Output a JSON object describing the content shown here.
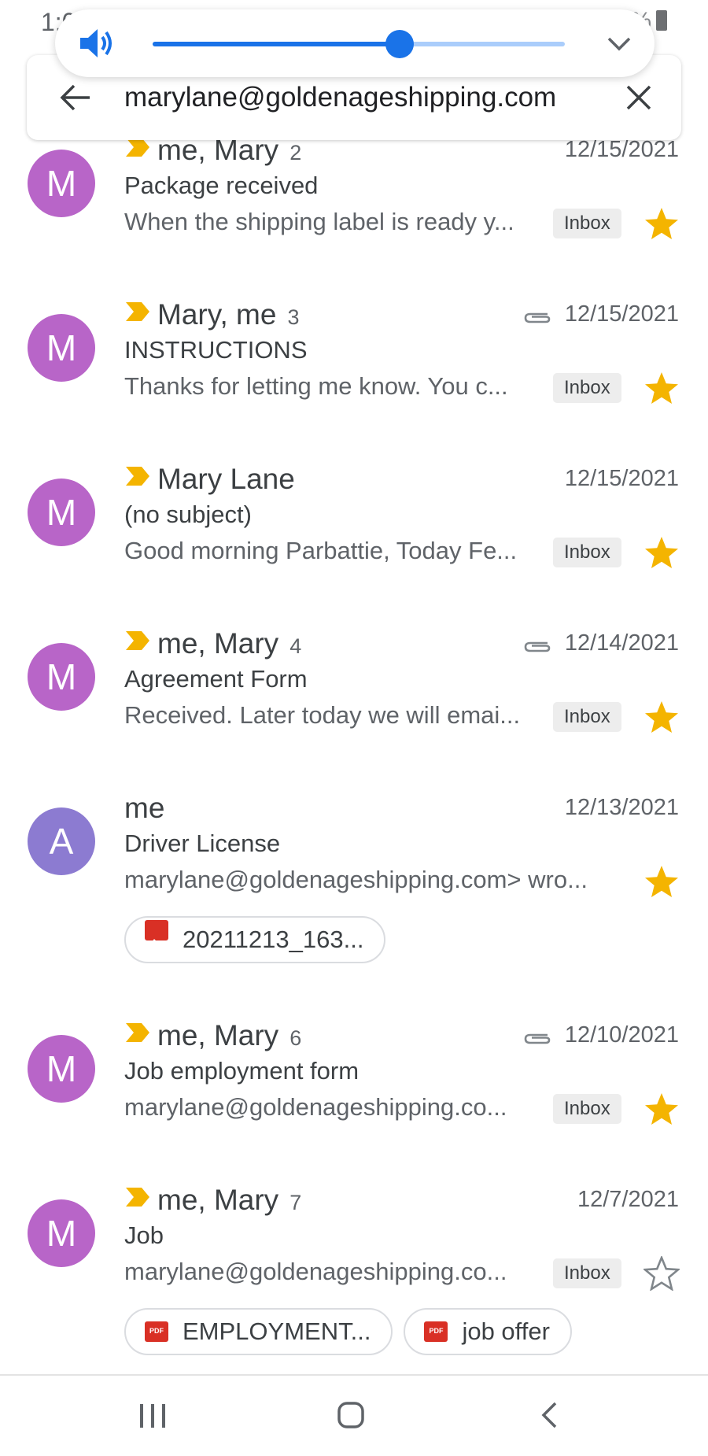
{
  "status_bar": {
    "time": "1:03",
    "battery": "34%",
    "notification_glyphs": "▬ ◉ ▶ ◎ ▣ ▮ ◉ ✎ ▥ ⊡"
  },
  "volume": {
    "level": 0.6,
    "accent": "#1a73e8"
  },
  "search": {
    "query": "marylane@goldenageshipping.com"
  },
  "colors": {
    "avatar_m": "#b865c8",
    "avatar_a": "#8c7bd1",
    "important": "#f4b400",
    "star": "#f4b400",
    "attachment_red": "#d93025"
  },
  "emails": [
    {
      "avatar_letter": "M",
      "avatar_color": "#b865c8",
      "important": true,
      "sender": "me, Mary",
      "count": "2",
      "has_attachment": false,
      "date": "12/15/2021",
      "subject": "Package received",
      "snippet": "When the shipping label is ready y...",
      "label": "Inbox",
      "starred": true,
      "chips": []
    },
    {
      "avatar_letter": "M",
      "avatar_color": "#b865c8",
      "important": true,
      "sender": "Mary, me",
      "count": "3",
      "has_attachment": true,
      "date": "12/15/2021",
      "subject": "INSTRUCTIONS",
      "snippet": "Thanks for letting me know. You c...",
      "label": "Inbox",
      "starred": true,
      "chips": []
    },
    {
      "avatar_letter": "M",
      "avatar_color": "#b865c8",
      "important": true,
      "sender": "Mary Lane",
      "count": "",
      "has_attachment": false,
      "date": "12/15/2021",
      "subject": "(no subject)",
      "snippet": "Good morning Parbattie, Today Fe...",
      "label": "Inbox",
      "starred": true,
      "chips": []
    },
    {
      "avatar_letter": "M",
      "avatar_color": "#b865c8",
      "important": true,
      "sender": "me, Mary",
      "count": "4",
      "has_attachment": true,
      "date": "12/14/2021",
      "subject": "Agreement Form",
      "snippet": "Received. Later today we will emai...",
      "label": "Inbox",
      "starred": true,
      "chips": []
    },
    {
      "avatar_letter": "A",
      "avatar_color": "#8c7bd1",
      "important": false,
      "sender": "me",
      "count": "",
      "has_attachment": false,
      "date": "12/13/2021",
      "subject": "Driver License",
      "snippet": "marylane@goldenageshipping.com> wro...",
      "label": "",
      "starred": true,
      "chips": [
        {
          "name": "20211213_163...",
          "kind": "image"
        }
      ]
    },
    {
      "avatar_letter": "M",
      "avatar_color": "#b865c8",
      "important": true,
      "sender": "me, Mary",
      "count": "6",
      "has_attachment": true,
      "date": "12/10/2021",
      "subject": "Job employment form",
      "snippet": "marylane@goldenageshipping.co...",
      "label": "Inbox",
      "starred": true,
      "chips": []
    },
    {
      "avatar_letter": "M",
      "avatar_color": "#b865c8",
      "important": true,
      "sender": "me, Mary",
      "count": "7",
      "has_attachment": false,
      "date": "12/7/2021",
      "subject": "Job",
      "snippet": "marylane@goldenageshipping.co...",
      "label": "Inbox",
      "starred": false,
      "chips": [
        {
          "name": "EMPLOYMENT...",
          "kind": "pdf"
        },
        {
          "name": "job offer",
          "kind": "pdf"
        }
      ]
    }
  ],
  "nav": {
    "recents_icon": "recents-icon",
    "home_icon": "home-icon",
    "back_icon": "back-icon"
  }
}
